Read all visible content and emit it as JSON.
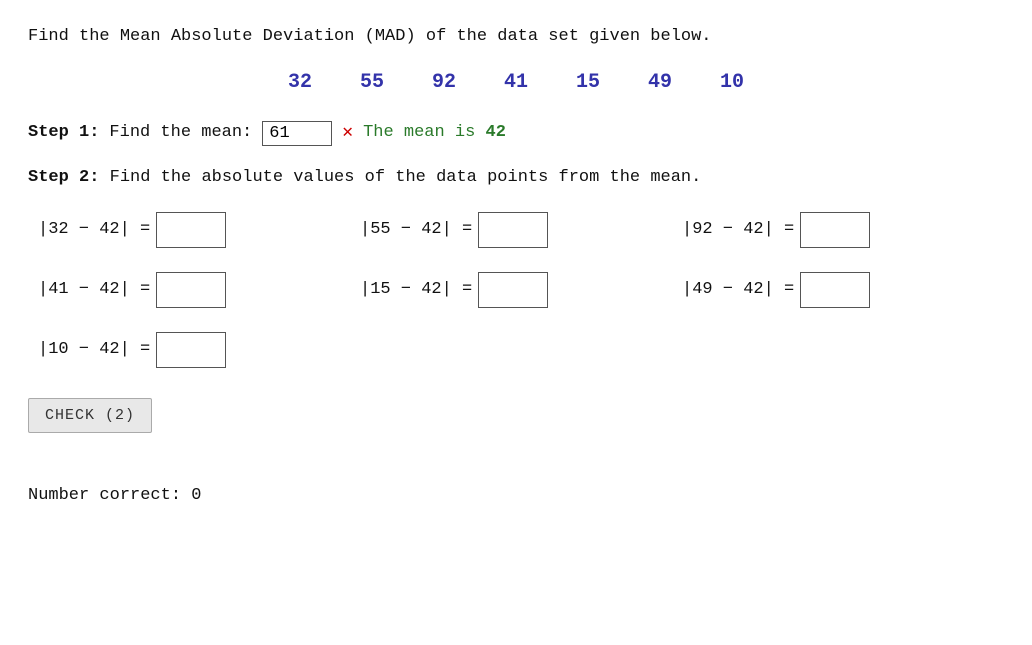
{
  "instructions": "Find the Mean Absolute Deviation (MAD) of the data set given below.",
  "data_set": {
    "values": [
      "32",
      "55",
      "92",
      "41",
      "15",
      "49",
      "10"
    ]
  },
  "step1": {
    "label": "Step 1:",
    "text": "Find the mean:",
    "input_value": "61",
    "x_mark": "✕",
    "hint": "The mean is ",
    "hint_bold": "42"
  },
  "step2": {
    "label": "Step 2:",
    "text": "Find the absolute values of the data points from the mean."
  },
  "abs_equations": [
    {
      "label": "|32 − 42| =",
      "id": "abs1"
    },
    {
      "label": "|55 − 42| =",
      "id": "abs2"
    },
    {
      "label": "|92 − 42| =",
      "id": "abs3"
    },
    {
      "label": "|41 − 42| =",
      "id": "abs4"
    },
    {
      "label": "|15 − 42| =",
      "id": "abs5"
    },
    {
      "label": "|49 − 42| =",
      "id": "abs6"
    },
    {
      "label": "|10 − 42| =",
      "id": "abs7"
    }
  ],
  "check_button": {
    "label": "CHECK (2)"
  },
  "number_correct": {
    "label": "Number correct: 0"
  }
}
